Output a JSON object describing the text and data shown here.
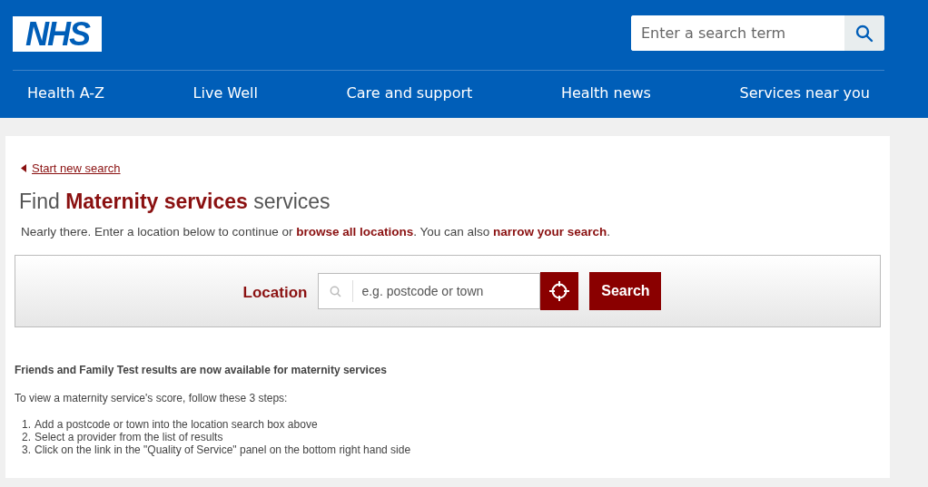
{
  "header": {
    "logo": "NHS",
    "search": {
      "placeholder": "Enter a search term"
    },
    "nav": [
      {
        "label": "Health A-Z"
      },
      {
        "label": "Live Well"
      },
      {
        "label": "Care and support"
      },
      {
        "label": "Health news"
      },
      {
        "label": "Services near you"
      }
    ]
  },
  "back_link": "Start new search",
  "heading": {
    "prefix": "Find",
    "highlight": "Maternity services",
    "suffix": "services"
  },
  "intro": [
    {
      "kind": "text",
      "text": "Nearly there. Enter a location below to continue or "
    },
    {
      "kind": "link",
      "text": "browse all locations"
    },
    {
      "kind": "text",
      "text": ". You can also "
    },
    {
      "kind": "link",
      "text": "narrow your search"
    },
    {
      "kind": "text",
      "text": "."
    }
  ],
  "location_search": {
    "label": "Location",
    "placeholder": "e.g. postcode or town",
    "button": "Search"
  },
  "notice": {
    "title": "Friends and Family Test results are now available for maternity services",
    "lead": "To view a maternity service's score, follow these 3 steps:",
    "steps": [
      {
        "number": "1.",
        "text": "Add a postcode or town into the location search box above"
      },
      {
        "number": "2.",
        "text": "Select a provider from the list of results"
      },
      {
        "number": "3.",
        "text": "Click on the link in the \"Quality of Service\" panel on the bottom right hand side"
      }
    ]
  }
}
